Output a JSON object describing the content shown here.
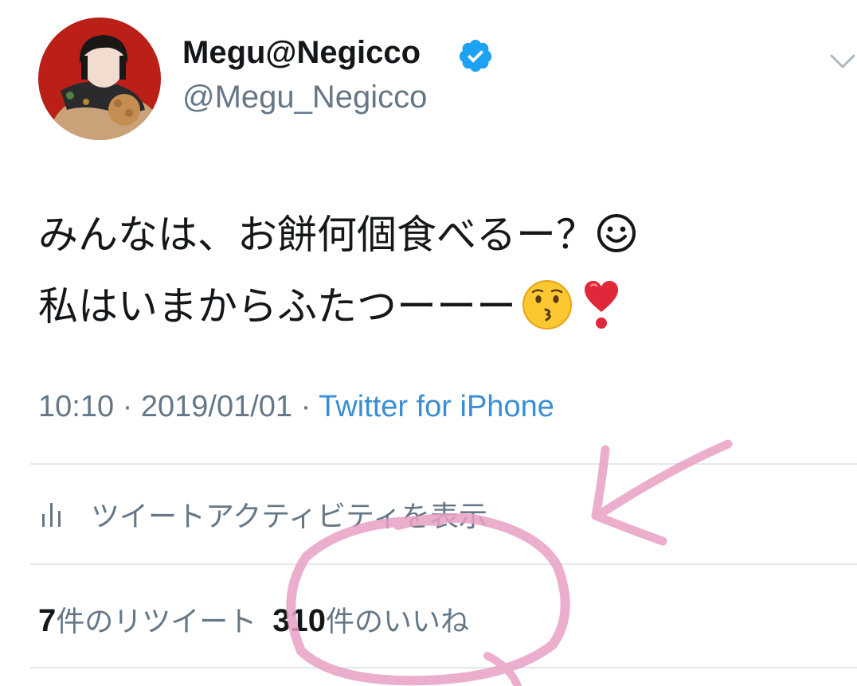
{
  "author": {
    "display_name": "Megu@Negicco",
    "handle": "@Megu_Negicco",
    "verified": true
  },
  "tweet": {
    "line1": "みんなは、お餅何個食べるー？",
    "line2": "私はいまからふたつーーー",
    "line1_emoji": "smiling-face-emoji",
    "line2_emojis": [
      "kissing-face-emoji",
      "heart-exclamation-emoji"
    ]
  },
  "meta": {
    "time": "10:10",
    "separator": " · ",
    "date": "2019/01/01",
    "source": "Twitter for iPhone"
  },
  "activity": {
    "label": "ツイートアクティビティを表示",
    "icon": "bar-chart-icon"
  },
  "stats": {
    "retweets_count": "7",
    "retweets_label": "件のリツイート",
    "likes_count": "310",
    "likes_label": "件のいいね"
  },
  "colors": {
    "text": "#14171a",
    "secondary": "#657786",
    "link": "#3a8ed5",
    "verified": "#1da1f2",
    "annotation": "#e8a0c4",
    "avatar_bg": "#c4231a"
  }
}
